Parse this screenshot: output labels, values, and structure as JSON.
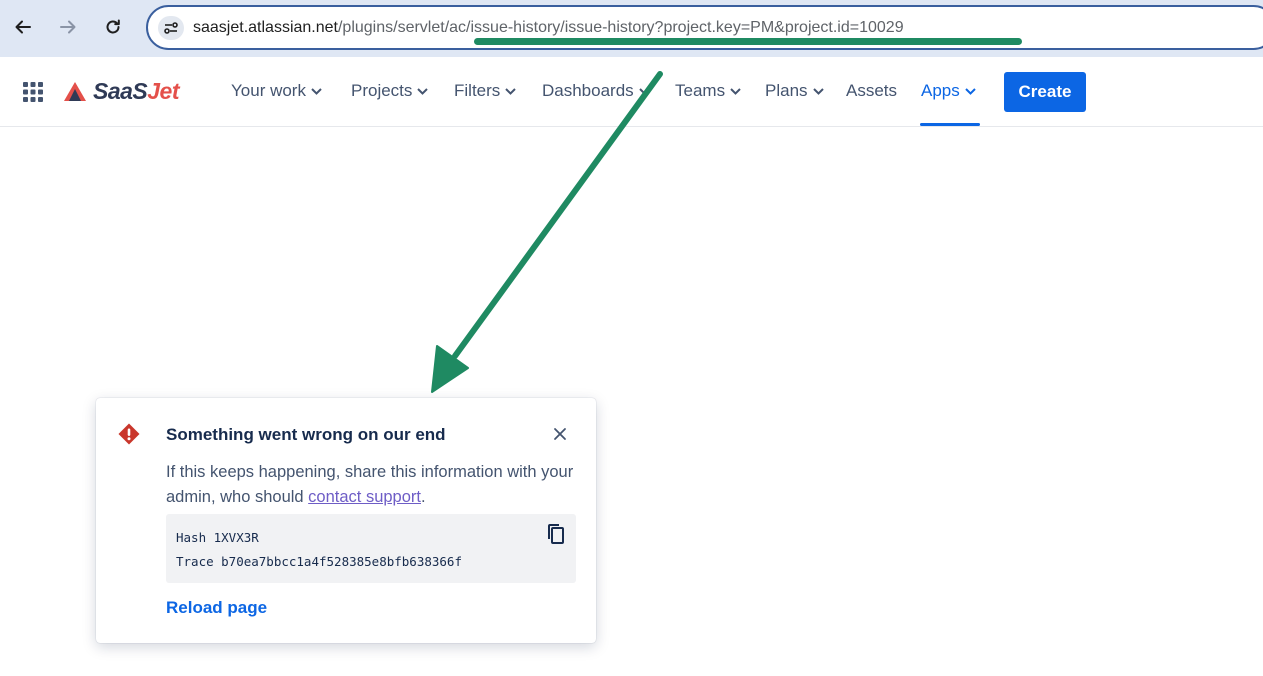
{
  "browser": {
    "url_host": "saasjet.atlassian.net",
    "url_path": "/plugins/servlet/ac/issue-history/issue-history?project.key=PM&project.id=10029",
    "back_icon": "arrow-left-icon",
    "forward_icon": "arrow-right-icon",
    "reload_icon": "reload-icon"
  },
  "topnav": {
    "logo_part1": "SaaS",
    "logo_part2": "Jet",
    "items": [
      {
        "label": "Your work",
        "dropdown": true
      },
      {
        "label": "Projects",
        "dropdown": true
      },
      {
        "label": "Filters",
        "dropdown": true
      },
      {
        "label": "Dashboards",
        "dropdown": true
      },
      {
        "label": "Teams",
        "dropdown": true
      },
      {
        "label": "Plans",
        "dropdown": true
      },
      {
        "label": "Assets",
        "dropdown": false
      },
      {
        "label": "Apps",
        "dropdown": true,
        "active": true
      }
    ],
    "create_label": "Create"
  },
  "flag": {
    "title": "Something went wrong on our end",
    "body_text": "If this keeps happening, share this information with your admin, who should ",
    "link_text": "contact support",
    "body_end": ".",
    "hash_line": "Hash 1XVX3R",
    "trace_line": "Trace b70ea7bbcc1a4f528385e8bfb638366f",
    "reload_label": "Reload page",
    "icon": "error-icon",
    "close_icon": "close-icon",
    "copy_icon": "copy-icon"
  },
  "colors": {
    "accent": "#0c66e4",
    "error": "#c9372c",
    "annotation": "#1f8a62"
  }
}
